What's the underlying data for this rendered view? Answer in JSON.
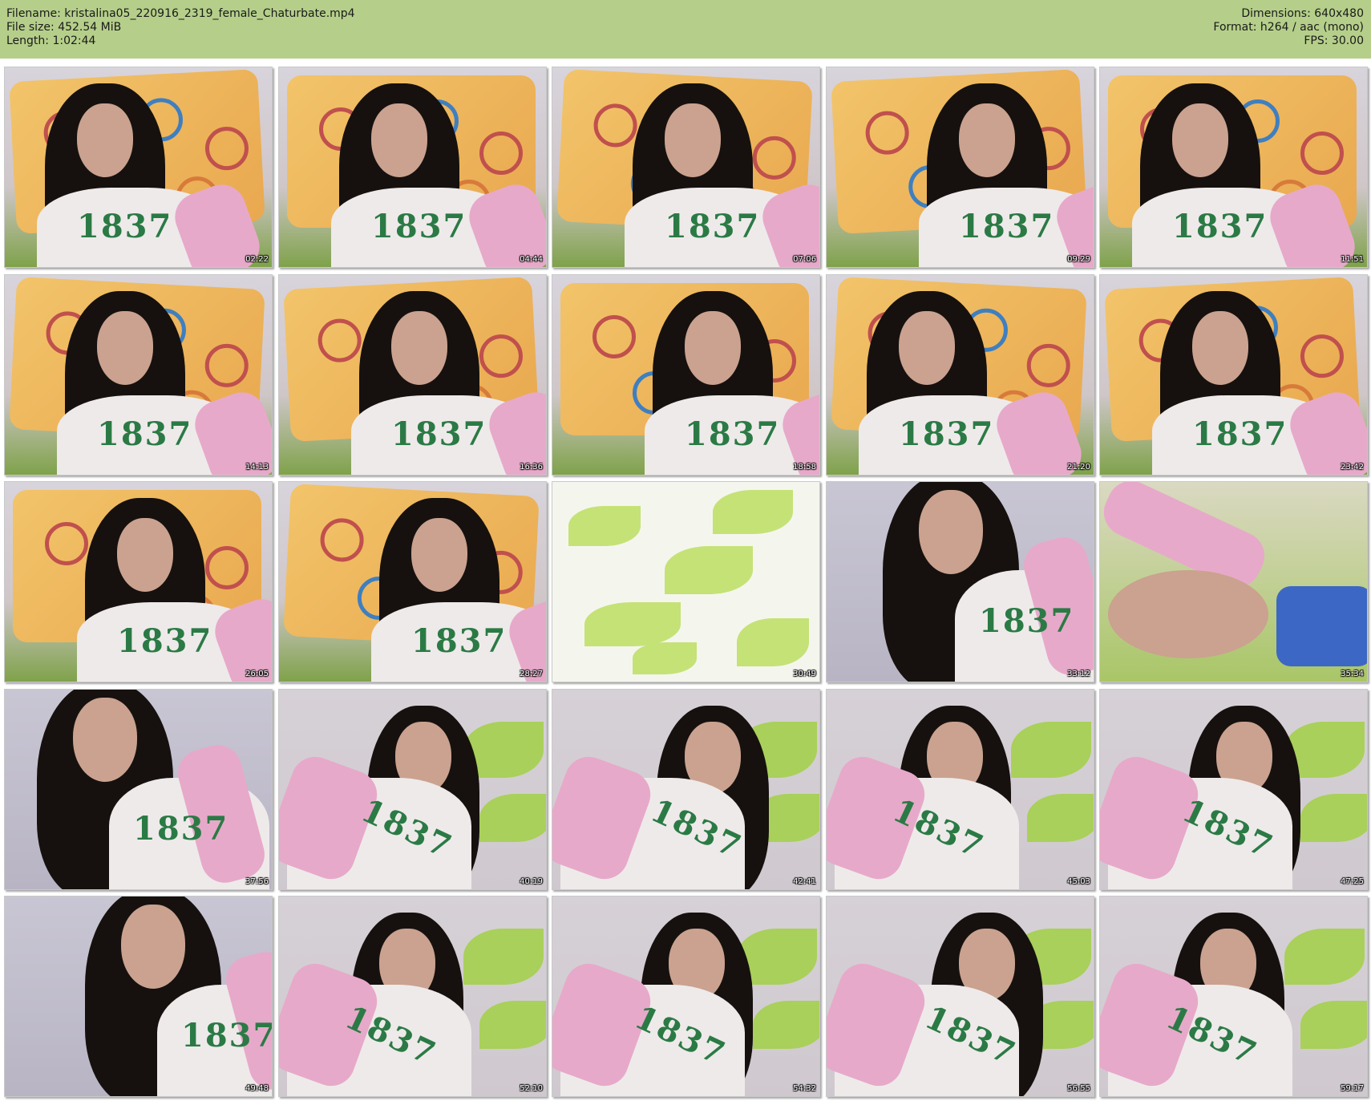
{
  "header": {
    "filename": "Filename: kristalina05_220916_2319_female_Chaturbate.mp4",
    "filesize": "File size: 452.54 MiB",
    "length": "Length: 1:02:44",
    "dimensions": "Dimensions: 640x480",
    "format": "Format: h264 / aac (mono)",
    "fps": "FPS: 30.00",
    "background_color": "#b5cf8a"
  },
  "thumbnails": [
    {
      "timestamp": "02:22",
      "scene": "pillow"
    },
    {
      "timestamp": "04:44",
      "scene": "pillow"
    },
    {
      "timestamp": "07:06",
      "scene": "pillow"
    },
    {
      "timestamp": "09:29",
      "scene": "pillow"
    },
    {
      "timestamp": "11:51",
      "scene": "pillow"
    },
    {
      "timestamp": "14:13",
      "scene": "pillow"
    },
    {
      "timestamp": "16:36",
      "scene": "pillow"
    },
    {
      "timestamp": "18:58",
      "scene": "pillow"
    },
    {
      "timestamp": "21:20",
      "scene": "pillow"
    },
    {
      "timestamp": "23:42",
      "scene": "pillow"
    },
    {
      "timestamp": "26:05",
      "scene": "pillow"
    },
    {
      "timestamp": "28:27",
      "scene": "pillow"
    },
    {
      "timestamp": "30:49",
      "scene": "sheet"
    },
    {
      "timestamp": "33:12",
      "scene": "room"
    },
    {
      "timestamp": "35:34",
      "scene": "legs"
    },
    {
      "timestamp": "37:56",
      "scene": "room"
    },
    {
      "timestamp": "40:19",
      "scene": "leaves"
    },
    {
      "timestamp": "42:41",
      "scene": "leaves"
    },
    {
      "timestamp": "45:03",
      "scene": "leaves"
    },
    {
      "timestamp": "47:25",
      "scene": "leaves"
    },
    {
      "timestamp": "49:48",
      "scene": "room"
    },
    {
      "timestamp": "52:10",
      "scene": "leaves"
    },
    {
      "timestamp": "54:32",
      "scene": "leaves"
    },
    {
      "timestamp": "56:55",
      "scene": "leaves"
    },
    {
      "timestamp": "59:17",
      "scene": "leaves"
    }
  ]
}
